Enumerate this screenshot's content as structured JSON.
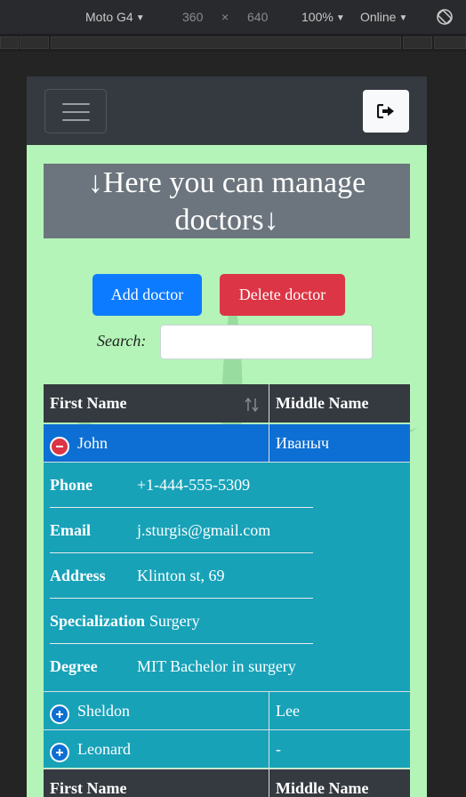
{
  "devtools": {
    "device": "Moto G4",
    "width": "360",
    "times": "×",
    "height": "640",
    "zoom": "100%",
    "network": "Online"
  },
  "navbar": {
    "logout_icon": "sign-out-icon"
  },
  "page": {
    "heading": "↓Here you can manage doctors↓"
  },
  "actions": {
    "add_label": "Add doctor",
    "delete_label": "Delete doctor"
  },
  "search": {
    "label": "Search:",
    "value": ""
  },
  "table": {
    "columns": [
      "First Name",
      "Middle Name"
    ],
    "rows": [
      {
        "first": "John",
        "middle": "Иваныч",
        "expanded": true
      },
      {
        "first": "Sheldon",
        "middle": "Lee",
        "expanded": false
      },
      {
        "first": "Leonard",
        "middle": "-",
        "expanded": false
      }
    ],
    "details": [
      {
        "key": "Phone",
        "value": "+1-444-555-5309"
      },
      {
        "key": "Email",
        "value": "j.sturgis@gmail.com"
      },
      {
        "key": "Address",
        "value": "Klinton st, 69"
      },
      {
        "key": "Specialization",
        "value": "Surgery"
      },
      {
        "key": "Degree",
        "value": "MIT Bachelor in surgery"
      }
    ],
    "footer_columns": [
      "First Name",
      "Middle Name"
    ]
  },
  "colors": {
    "background": "#b4f4b8",
    "navbar": "#343a40",
    "primary": "#0d7bff",
    "danger": "#dc3545",
    "info": "#17a2b8"
  }
}
